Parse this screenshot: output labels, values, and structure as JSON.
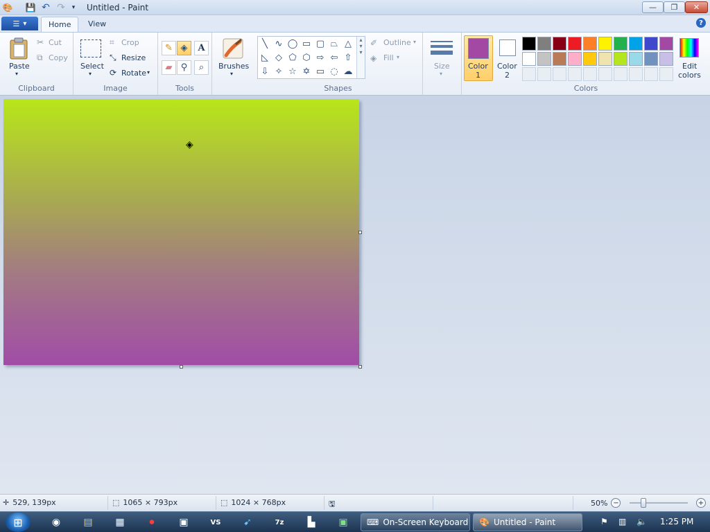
{
  "window": {
    "title": "Untitled - Paint",
    "minimize": "—",
    "maximize": "❐",
    "close": "✕"
  },
  "ribbon_tabs": {
    "file_menu": "▾",
    "home": "Home",
    "view": "View"
  },
  "clipboard": {
    "paste": "Paste",
    "cut": "Cut",
    "copy": "Copy",
    "group": "Clipboard"
  },
  "image": {
    "select": "Select",
    "crop": "Crop",
    "resize": "Resize",
    "rotate": "Rotate",
    "group": "Image"
  },
  "tools": {
    "group": "Tools",
    "text_glyph": "A"
  },
  "brushes": {
    "label": "Brushes"
  },
  "shapes": {
    "outline": "Outline",
    "fill": "Fill",
    "group": "Shapes"
  },
  "size": {
    "label": "Size"
  },
  "colors": {
    "color1": "Color\n1",
    "color1_line1": "Color",
    "color1_line2": "1",
    "color2_line1": "Color",
    "color2_line2": "2",
    "edit_line1": "Edit",
    "edit_line2": "colors",
    "group": "Colors",
    "color1_value": "#a349a4",
    "color2_value": "#ffffff",
    "palette_row1": [
      "#000000",
      "#7f7f7f",
      "#880015",
      "#ed1c24",
      "#ff7f27",
      "#fff200",
      "#22b14c",
      "#00a2e8",
      "#3f48cc",
      "#a349a4"
    ],
    "palette_row2": [
      "#ffffff",
      "#c3c3c3",
      "#b97a57",
      "#ffaec9",
      "#ffc90e",
      "#efe4b0",
      "#b5e61d",
      "#99d9ea",
      "#7092be",
      "#c8bfe7"
    ]
  },
  "status": {
    "cursor_pos": "529, 139px",
    "selection_size": "1065 × 793px",
    "image_size": "1024 × 768px",
    "zoom": "50%"
  },
  "taskbar": {
    "keyboard_task": "On-Screen Keyboard",
    "paint_task": "Untitled - Paint",
    "clock": "1:25 PM"
  }
}
